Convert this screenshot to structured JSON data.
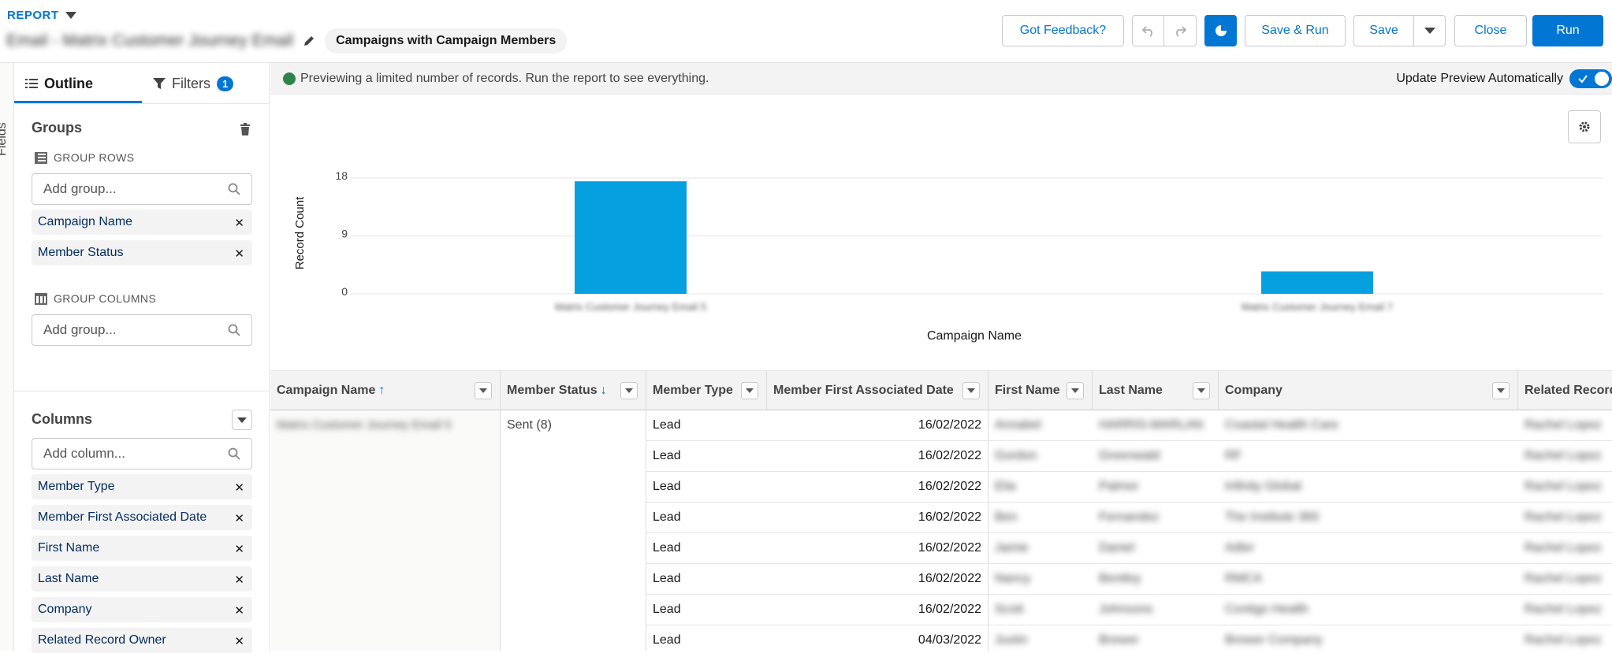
{
  "header": {
    "report_label": "REPORT",
    "title": "Email - Matrix Customer Journey Email",
    "report_type": "Campaigns with Campaign Members",
    "buttons": {
      "feedback": "Got Feedback?",
      "save_run": "Save & Run",
      "save": "Save",
      "close": "Close",
      "run": "Run"
    }
  },
  "fields_rail": {
    "label": "Fields"
  },
  "left_panel": {
    "tabs": {
      "outline": "Outline",
      "filters": "Filters",
      "filters_count": "1"
    },
    "groups": {
      "title": "Groups",
      "group_rows_label": "GROUP ROWS",
      "group_rows_placeholder": "Add group...",
      "group_rows": [
        "Campaign Name",
        "Member Status"
      ],
      "group_columns_label": "GROUP COLUMNS",
      "group_columns_placeholder": "Add group..."
    },
    "columns": {
      "title": "Columns",
      "placeholder": "Add column...",
      "items": [
        "Member Type",
        "Member First Associated Date",
        "First Name",
        "Last Name",
        "Company",
        "Related Record Owner"
      ]
    }
  },
  "preview": {
    "message": "Previewing a limited number of records. Run the report to see everything.",
    "auto_label": "Update Preview Automatically"
  },
  "chart_data": {
    "type": "bar",
    "categories": [
      "Matrix Customer Journey Email 5",
      "Matrix Customer Journey Email 7"
    ],
    "values": [
      17,
      3
    ],
    "xlabel": "Campaign Name",
    "ylabel": "Record Count",
    "yticks": [
      "18",
      "9",
      "0"
    ],
    "ylim": [
      0,
      18
    ],
    "bar_color": "#04a0e0",
    "grid": true
  },
  "table": {
    "headers": [
      "Campaign Name",
      "Member Status",
      "Member Type",
      "Member First Associated Date",
      "First Name",
      "Last Name",
      "Company",
      "Related Record"
    ],
    "group_campaign": "Matrix Customer Journey Email 5",
    "group_status": "Sent (8)",
    "rows": [
      {
        "type": "Lead",
        "date": "16/02/2022",
        "first": "Annabel",
        "last": "HARRIS-MARLAN",
        "company": "Coastal Health Care",
        "owner": "Rachel Lopez"
      },
      {
        "type": "Lead",
        "date": "16/02/2022",
        "first": "Gordon",
        "last": "Greenwald",
        "company": "RF",
        "owner": "Rachel Lopez"
      },
      {
        "type": "Lead",
        "date": "16/02/2022",
        "first": "Elia",
        "last": "Palmer",
        "company": "Infinity Global",
        "owner": "Rachel Lopez"
      },
      {
        "type": "Lead",
        "date": "16/02/2022",
        "first": "Ben",
        "last": "Fernandez",
        "company": "The Institute 360",
        "owner": "Rachel Lopez"
      },
      {
        "type": "Lead",
        "date": "16/02/2022",
        "first": "Jamie",
        "last": "Daniel",
        "company": "Adler",
        "owner": "Rachel Lopez"
      },
      {
        "type": "Lead",
        "date": "16/02/2022",
        "first": "Nancy",
        "last": "Bentley",
        "company": "RMCA",
        "owner": "Rachel Lopez"
      },
      {
        "type": "Lead",
        "date": "16/02/2022",
        "first": "Scott",
        "last": "Johnsons",
        "company": "Contigo Health",
        "owner": "Rachel Lopez"
      },
      {
        "type": "Lead",
        "date": "04/03/2022",
        "first": "Justin",
        "last": "Brewer",
        "company": "Brewer Company",
        "owner": "Rachel Lopez"
      }
    ]
  }
}
